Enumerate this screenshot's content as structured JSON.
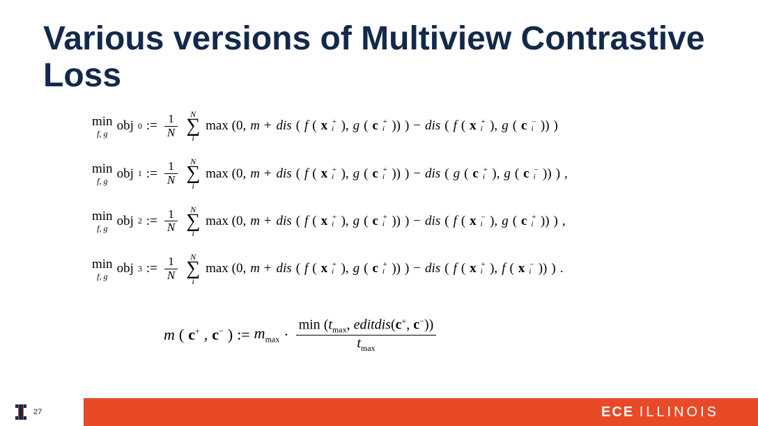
{
  "title": "Various versions of Multiview Contrastive Loss",
  "common": {
    "min": "min",
    "fg": "f, g",
    "obj": "obj",
    "assign": " := ",
    "oneOverN_num": "1",
    "oneOverN_den": "N",
    "sum_top": "N",
    "sum_bot": "i",
    "max0": "max (0, ",
    "m_plus": "m + ",
    "dis": "dis",
    "minus": " − ",
    "lp": "(",
    "rp": ")",
    "f": "f",
    "g": "g",
    "x": "x",
    "c": "c",
    "i": "i",
    "plus": "+",
    "neg": "−",
    "comma": ", ",
    "close_punc_comma": " ,",
    "close_punc_period": " ."
  },
  "rows": [
    {
      "sup": "0",
      "negA_fn": "f",
      "negA_var": "x",
      "negA_sign": "+",
      "negB_fn": "g",
      "negB_var": "c",
      "negB_sign": "−",
      "trail": ""
    },
    {
      "sup": "1",
      "negA_fn": "g",
      "negA_var": "c",
      "negA_sign": "+",
      "negB_fn": "g",
      "negB_var": "c",
      "negB_sign": "−",
      "trail": " ,"
    },
    {
      "sup": "2",
      "negA_fn": "f",
      "negA_var": "x",
      "negA_sign": "−",
      "negB_fn": "g",
      "negB_var": "c",
      "negB_sign": "+",
      "trail": " ,"
    },
    {
      "sup": "3",
      "negA_fn": "f",
      "negA_var": "x",
      "negA_sign": "+",
      "negB_fn": "f",
      "negB_var": "x",
      "negB_sign": "−",
      "trail": " ."
    }
  ],
  "margin": {
    "lhs_m": "m",
    "lhs_open": "(",
    "c_plus": "c",
    "c_plus_sup": "+",
    "sep": ", ",
    "c_minus": "c",
    "c_minus_sup": "−",
    "lhs_close": ")",
    "assign": " := ",
    "mmax": "m",
    "mmax_sub": "max",
    "dot": " · ",
    "num_min": "min",
    "num_open": " (",
    "tmax_t": "t",
    "tmax_sub": "max",
    "num_sep": ", ",
    "editdis": "editdis",
    "num_ed_open": "(",
    "num_ed_close": ")",
    "num_close": ")",
    "den_t": "t",
    "den_sub": "max"
  },
  "footer": {
    "page": "27",
    "ece": "ECE",
    "illinois": "ILLINOIS"
  }
}
